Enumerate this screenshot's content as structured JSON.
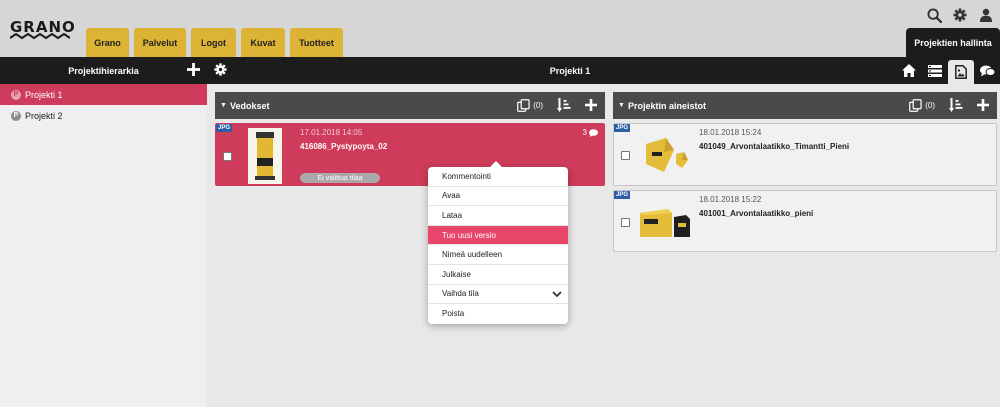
{
  "header": {
    "logo": "GRANO",
    "tabs": [
      "Grano",
      "Palvelut",
      "Logot",
      "Kuvat",
      "Tuotteet"
    ],
    "admin_tab": "Projektien hallinta"
  },
  "toolbar": {
    "left_title": "Projektihierarkia",
    "center_title": "Projekti 1"
  },
  "sidebar": {
    "items": [
      {
        "badge": "P",
        "label": "Projekti 1",
        "active": true
      },
      {
        "badge": "P",
        "label": "Projekti 2",
        "active": false
      }
    ]
  },
  "vedokset": {
    "title": "Vedokset",
    "count": "(0)",
    "cards": [
      {
        "badge": "JPG",
        "date": "17.01.2018 14:05",
        "name": "416086_Pystypoyta_02",
        "status": "Ei valittua tilaa",
        "comments": "3"
      }
    ]
  },
  "aineistot": {
    "title": "Projektin aineistot",
    "count": "(0)",
    "cards": [
      {
        "badge": "JPG",
        "date": "18.01.2018 15:24",
        "name": "401049_Arvontalaatikko_Timantti_Pieni"
      },
      {
        "badge": "JPG",
        "date": "18.01.2018 15:22",
        "name": "401001_Arvontalaatikko_pieni"
      }
    ]
  },
  "context_menu": {
    "items": [
      "Kommentointi",
      "Avaa",
      "Lataa",
      "Tuo uusi versio",
      "Nimeä uudelleen",
      "Julkaise",
      "Vaihda tila",
      "Poista"
    ],
    "highlighted_index": 3
  },
  "colors": {
    "accent": "#cf3b5a",
    "highlight": "#e8466a",
    "tab_yellow": "#dcb334",
    "dark": "#1c1c1c",
    "panel_header": "#4a4a4a"
  },
  "icons": {
    "top": [
      "search-icon",
      "gear-icon",
      "user-icon"
    ],
    "views": [
      "home-icon",
      "list-icon",
      "image-icon",
      "chat-icon"
    ]
  }
}
